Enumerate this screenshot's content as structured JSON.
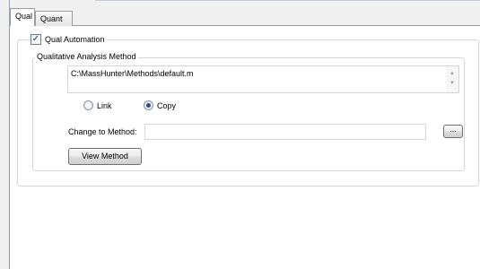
{
  "tabs": [
    {
      "label": "Qual",
      "active": true
    },
    {
      "label": "Quant",
      "active": false
    }
  ],
  "qual_automation": {
    "label": "Qual Automation",
    "checked": true
  },
  "method_group": {
    "title": "Qualitative Analysis Method",
    "method_path": "C:\\MassHunter\\Methods\\default.m",
    "link_label": "Link",
    "copy_label": "Copy",
    "selected_option": "Copy",
    "change_to_method_label": "Change to Method:",
    "change_to_method_value": "",
    "browse_label": "...",
    "view_method_label": "View Method"
  },
  "icons": {
    "scroll_up": "scroll-up-icon",
    "scroll_down": "scroll-down-icon",
    "check": "checkmark-icon"
  }
}
